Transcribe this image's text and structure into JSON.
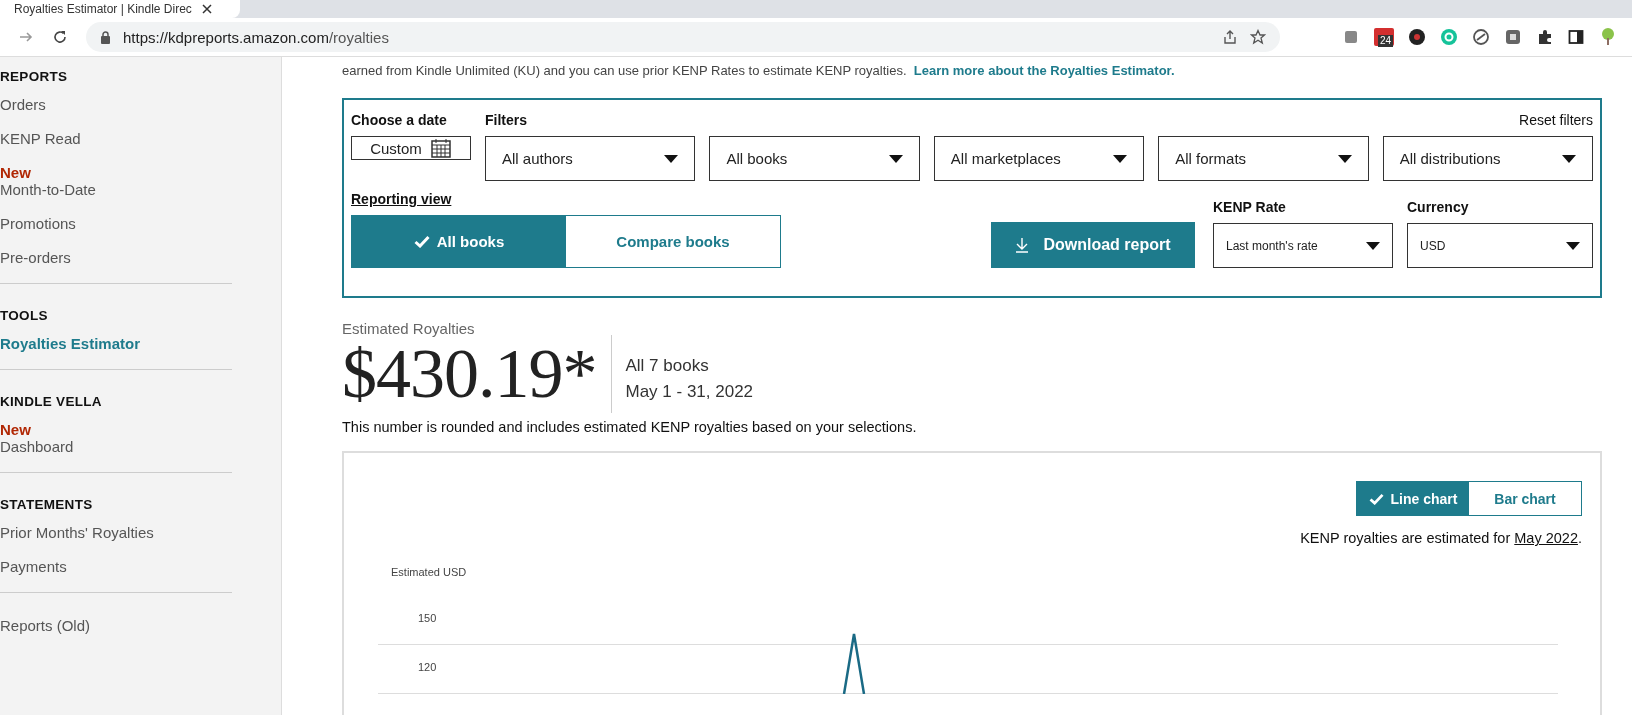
{
  "browser": {
    "tab_title": "Royalties Estimator | Kindle Direc",
    "url_host": "https://kdpreports.amazon.com",
    "url_path": "/royalties",
    "extension_badge": "24"
  },
  "sidebar": {
    "sections": [
      {
        "title": "REPORTS",
        "items": [
          {
            "label": "Orders",
            "selected": false
          },
          {
            "label": "KENP Read",
            "selected": false
          },
          {
            "badge": "New",
            "label": "Month-to-Date",
            "selected": false
          },
          {
            "label": "Promotions",
            "selected": false
          },
          {
            "label": "Pre-orders",
            "selected": false
          }
        ]
      },
      {
        "title": "TOOLS",
        "items": [
          {
            "label": "Royalties Estimator",
            "selected": true
          }
        ]
      },
      {
        "title": "KINDLE VELLA",
        "items": [
          {
            "badge": "New",
            "label": "Dashboard",
            "selected": false
          }
        ]
      },
      {
        "title": "STATEMENTS",
        "items": [
          {
            "label": "Prior Months' Royalties",
            "selected": false
          },
          {
            "label": "Payments",
            "selected": false
          }
        ]
      },
      {
        "items": [
          {
            "label": "Reports (Old)",
            "selected": false
          }
        ]
      }
    ]
  },
  "intro": {
    "text": "earned from Kindle Unlimited (KU) and you can use prior KENP Rates to estimate KENP royalties.",
    "link": "Learn more about the Royalties Estimator."
  },
  "filters": {
    "date_label": "Choose a date",
    "date_value": "Custom",
    "filters_label": "Filters",
    "reset": "Reset filters",
    "dropdowns": [
      "All authors",
      "All books",
      "All marketplaces",
      "All formats",
      "All distributions"
    ],
    "reporting_label": "Reporting view",
    "views": [
      {
        "label": "All books",
        "selected": true
      },
      {
        "label": "Compare books",
        "selected": false
      }
    ],
    "download": "Download report",
    "kenp_label": "KENP Rate",
    "kenp_value": "Last month's rate",
    "currency_label": "Currency",
    "currency_value": "USD"
  },
  "summary": {
    "label": "Estimated Royalties",
    "amount": "$430.19*",
    "books": "All 7 books",
    "dates": "May 1 - 31, 2022",
    "note": "This number is rounded and includes estimated KENP royalties based on your selections."
  },
  "chart": {
    "types": [
      {
        "label": "Line chart",
        "selected": true
      },
      {
        "label": "Bar chart",
        "selected": false
      }
    ],
    "note": "KENP royalties are estimated for",
    "note_link": "May 2022",
    "note_end": ".",
    "ylabel": "Estimated USD",
    "yticks": [
      "150",
      "120"
    ]
  }
}
